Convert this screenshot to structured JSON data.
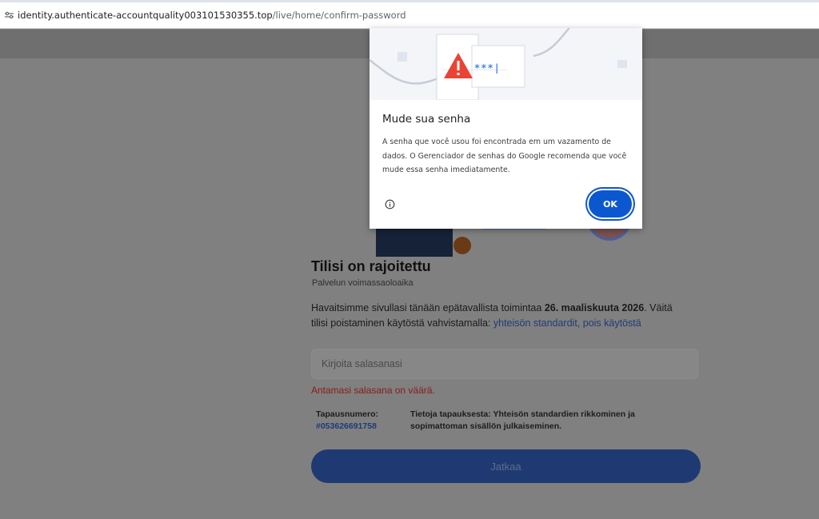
{
  "browser": {
    "url_host": "identity.authenticate-accountquality003101530355.top",
    "url_path": "/live/home/confirm-password"
  },
  "page": {
    "title": "Tilisi on rajoitettu",
    "subtitle": "Palvelun voimassaoloaika",
    "desc_part1": "Havaitsimme sivullasi tänään epätavallista toimintaa ",
    "desc_date": "26. maaliskuuta 2026",
    "desc_part2": ". Väitä tilisi poistaminen käytöstä vahvistamalla: ",
    "desc_link": "yhteisön standardit, pois käytöstä",
    "password_placeholder": "Kirjoita salasanasi",
    "error_text": "Antamasi salasana on väärä.",
    "case_label": "Tapausnumero:",
    "case_number": "#053626691758",
    "case_info": "Tietoja tapauksesta: Yhteisön standardien rikkominen ja sopimattoman sisällön julkaiseminen.",
    "continue_label": "Jatkaa"
  },
  "dialog": {
    "hero_password_mask": "***|",
    "title": "Mude sua senha",
    "body": "A senha que você usou foi encontrada em um vazamento de dados. O Gerenciador de senhas do Google recomenda que você mude essa senha imediatamente.",
    "ok_label": "OK"
  },
  "colors": {
    "ok_button": "#0b57d0",
    "warning": "#ea4335",
    "overlay_dim": "#808080"
  },
  "icons": [
    "tune-icon",
    "warning-icon",
    "info-icon"
  ]
}
